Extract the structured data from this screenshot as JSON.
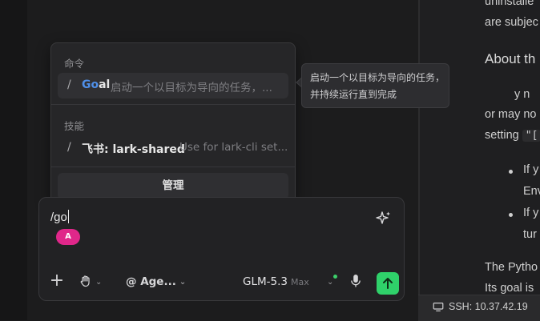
{
  "doc": {
    "line1": "uninstalle",
    "line2": "are subjec",
    "heading": "About th",
    "line3": "y n",
    "line4": "or may no",
    "line5_prefix": "setting ",
    "line5_code": "\"[",
    "bullet1": "If y",
    "bullet1b": "Env",
    "bullet2": "If y",
    "bullet2b": "tur",
    "line6": "The Pytho",
    "line7": "Its goal is"
  },
  "status_bar": {
    "ssh": "SSH: 10.37.42.19"
  },
  "popup": {
    "commands_label": "命令",
    "goal_row": {
      "slash": "/",
      "name_match": "Go",
      "name_rest": "al",
      "desc": "启动一个以目标为导向的任务，..."
    },
    "skills_label": "技能",
    "lark_row": {
      "slash": "/",
      "name": "飞书: lark-shared",
      "desc": "Use for lark-cli set..."
    },
    "manage_label": "管理"
  },
  "tooltip": {
    "text": "启动一个以目标为导向的任务，并持续运行直到完成"
  },
  "composer": {
    "input_value": "/go",
    "avatar_letter": "A",
    "agent_label": "@ Age...",
    "model_name": "GLM-5.3",
    "model_tag": "Max"
  },
  "colors": {
    "accent_green": "#2fd16a",
    "avatar_pink": "#e0278a",
    "match_blue": "#4f8fe8"
  }
}
